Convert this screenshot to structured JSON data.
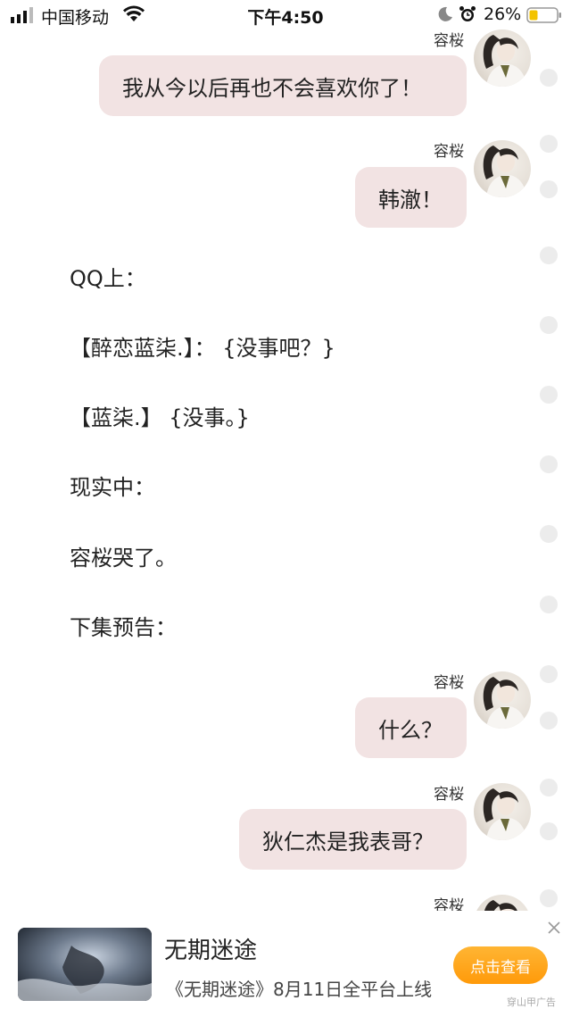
{
  "status_bar": {
    "carrier": "中国移动",
    "time": "下午4:50",
    "battery": "26%"
  },
  "chat": {
    "messages": [
      {
        "sender": "容桜",
        "text": "我从今以后再也不会喜欢你了！"
      },
      {
        "sender": "容桜",
        "text": "韩澈！"
      },
      {
        "sender": "容桜",
        "text": "什么？"
      },
      {
        "sender": "容桜",
        "text": "狄仁杰是我表哥？"
      },
      {
        "sender": "容桜",
        "text": ""
      }
    ],
    "narration": [
      "QQ上：",
      "【醉恋蓝柒.】： {没事吧？}",
      "【蓝柒.】 {没事。}",
      "现实中：",
      "容桜哭了。",
      "下集预告："
    ]
  },
  "ad": {
    "title": "无期迷途",
    "description": "《无期迷途》8月11日全平台上线",
    "cta": "点击查看",
    "tag": "穿山甲广告"
  },
  "colors": {
    "bubble": "#f2e3e3",
    "cta": "#ff9a0a"
  }
}
